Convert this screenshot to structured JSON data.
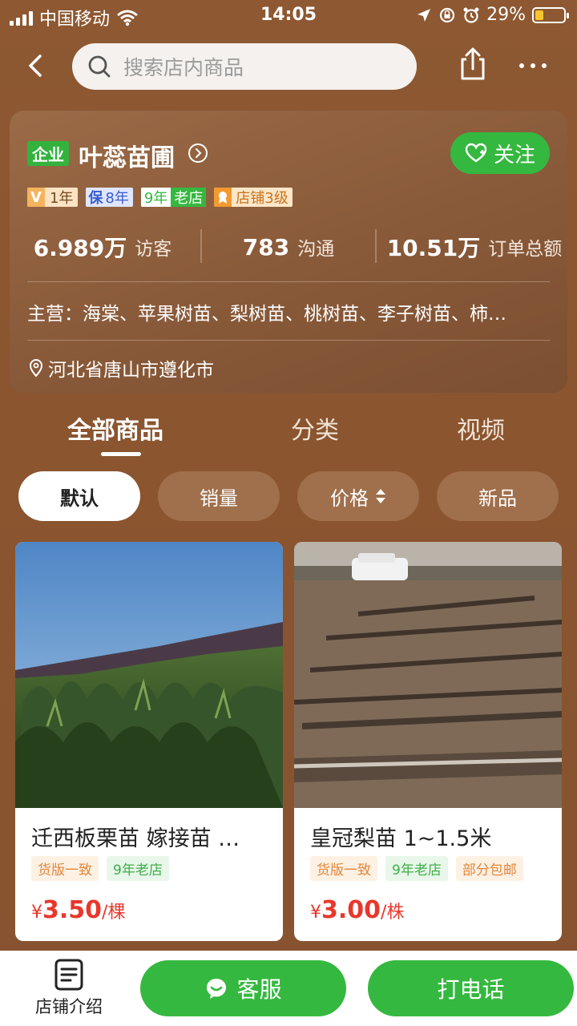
{
  "status_bar": {
    "carrier": "中国移动",
    "time": "14:05",
    "battery": "29%",
    "battery_level": 0.29
  },
  "search": {
    "placeholder": "搜索店内商品"
  },
  "store": {
    "badge": "企业",
    "name": "叶蕊苗圃",
    "follow_label": "关注",
    "badges": {
      "vip_key": "V",
      "vip_val": "1年",
      "bao_key": "保",
      "bao_val": "8年",
      "old_key": "9年",
      "old_val": "老店",
      "level_val": "店铺3级"
    },
    "stats": [
      {
        "num": "6.989万",
        "label": "访客"
      },
      {
        "num": "783",
        "label": "沟通"
      },
      {
        "num": "10.51万",
        "label": "订单总额"
      }
    ],
    "main_business": "主营：海棠、苹果树苗、梨树苗、桃树苗、李子树苗、柿…",
    "location": "河北省唐山市遵化市"
  },
  "tabs": [
    "全部商品",
    "分类",
    "视频"
  ],
  "filters": [
    "默认",
    "销量",
    "价格",
    "新品"
  ],
  "products": [
    {
      "title": "迁西板栗苗 嫁接苗 …",
      "tags": [
        "货版一致",
        "9年老店"
      ],
      "currency": "¥",
      "price": "3.50",
      "unit": "/棵"
    },
    {
      "title": "皇冠梨苗 1~1.5米",
      "tags": [
        "货版一致",
        "9年老店",
        "部分包邮"
      ],
      "currency": "¥",
      "price": "3.00",
      "unit": "/株"
    }
  ],
  "bottom_bar": {
    "intro_label": "店铺介绍",
    "service_label": "客服",
    "call_label": "打电话"
  },
  "colors": {
    "brand_green": "#35b83f",
    "price_red": "#e8372c",
    "background": "#8a5630"
  }
}
